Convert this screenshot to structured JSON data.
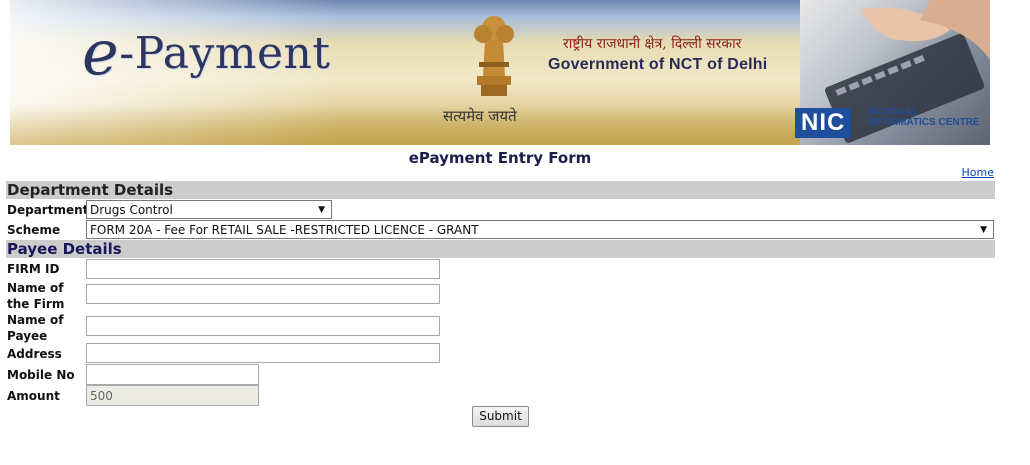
{
  "banner": {
    "logo_prefix": "e",
    "logo_rest": "-Payment",
    "motto": "सत्यमेव जयते",
    "govt_hindi": "राष्ट्रीय राजधानी क्षेत्र, दिल्ली सरकार",
    "govt_english": "Government of NCT of Delhi",
    "nic_logo": "NIC",
    "nic_subtitle": "NATIONAL INFORMATICS CENTRE",
    "emblem_icon": "state-emblem-icon"
  },
  "header": {
    "form_title": "ePayment Entry Form",
    "home_link": "Home"
  },
  "department_section": {
    "title": "Department Details",
    "department_label": "Department",
    "department_value": "Drugs Control",
    "scheme_label": "Scheme",
    "scheme_value": "FORM 20A - Fee For RETAIL SALE -RESTRICTED LICENCE - GRANT"
  },
  "payee_section": {
    "title": "Payee Details",
    "firm_id_label": "FIRM ID",
    "firm_id_value": "",
    "firm_name_label_1": "Name of",
    "firm_name_label_2": "the Firm",
    "firm_name_value": "",
    "payee_name_label_1": "Name of",
    "payee_name_label_2": "Payee",
    "payee_name_value": "",
    "address_label": "Address",
    "address_value": "",
    "mobile_label": "Mobile No",
    "mobile_value": "",
    "amount_label": "Amount",
    "amount_value": "500"
  },
  "actions": {
    "submit_label": "Submit"
  },
  "colors": {
    "section_bg": "#cccccc",
    "title_color": "#1c1c4a",
    "link_color": "#0645ad"
  }
}
